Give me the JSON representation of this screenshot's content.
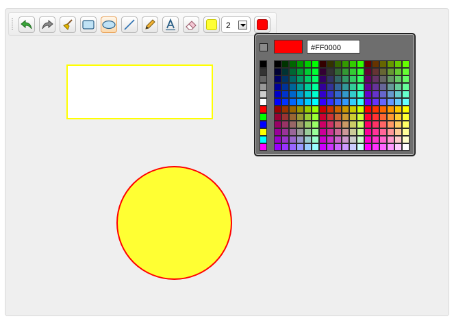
{
  "toolbar": {
    "tools": [
      {
        "name": "undo-button",
        "icon": "undo-arrow-icon"
      },
      {
        "name": "redo-button",
        "icon": "redo-arrow-icon"
      },
      {
        "name": "clear-brush-button",
        "icon": "broom-icon"
      },
      {
        "name": "rectangle-tool-button",
        "icon": "rectangle-icon"
      },
      {
        "name": "ellipse-tool-button",
        "icon": "ellipse-icon",
        "active": true
      },
      {
        "name": "line-tool-button",
        "icon": "line-icon"
      },
      {
        "name": "pencil-tool-button",
        "icon": "pencil-icon"
      },
      {
        "name": "text-tool-button",
        "icon": "text-a-icon"
      },
      {
        "name": "eraser-tool-button",
        "icon": "eraser-icon"
      }
    ],
    "fill_color": "#ffff33",
    "line_width": "2",
    "stroke_color": "#ff0000"
  },
  "canvas": {
    "rectangle": {
      "stroke": "#ffff00",
      "fill": "#ffffff"
    },
    "ellipse": {
      "stroke": "#ff0000",
      "fill": "#ffff33"
    }
  },
  "palette": {
    "selected_color": "#ff0000",
    "hex_value": "#FF0000",
    "left_column": [
      "#000000",
      "#333333",
      "#666666",
      "#999999",
      "#cccccc",
      "#ffffff",
      "#ff0000",
      "#00ff00",
      "#0000ff",
      "#ffff00",
      "#00ffff",
      "#ff00ff"
    ]
  }
}
